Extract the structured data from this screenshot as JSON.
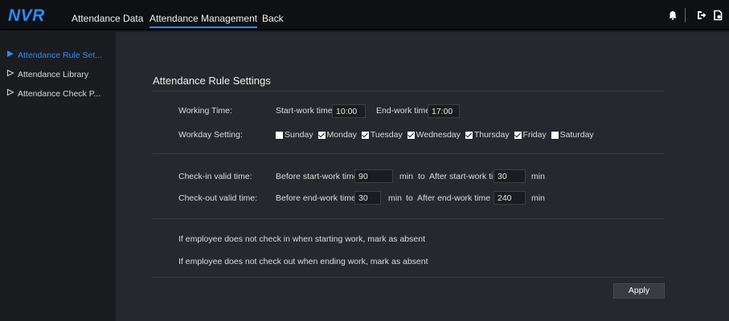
{
  "header": {
    "logo": "NVR",
    "nav": [
      "Attendance Data",
      "Attendance Management",
      "Back"
    ],
    "icons": [
      "bell-icon",
      "logout-icon",
      "export-icon"
    ]
  },
  "sidebar": {
    "items": [
      {
        "label": "Attendance Rule Set...",
        "active": true
      },
      {
        "label": "Attendance Library",
        "active": false
      },
      {
        "label": "Attendance Check P...",
        "active": false
      }
    ]
  },
  "main": {
    "title": "Attendance Rule Settings",
    "working_time": {
      "label": "Working Time:",
      "start_label": "Start-work time",
      "start_value": "10:00",
      "end_label": "End-work time",
      "end_value": "17:00"
    },
    "workday": {
      "label": "Workday Setting:",
      "days": [
        {
          "name": "Sunday",
          "checked": false
        },
        {
          "name": "Monday",
          "checked": true
        },
        {
          "name": "Tuesday",
          "checked": true
        },
        {
          "name": "Wednesday",
          "checked": true
        },
        {
          "name": "Thursday",
          "checked": true
        },
        {
          "name": "Friday",
          "checked": true
        },
        {
          "name": "Saturday",
          "checked": false
        }
      ]
    },
    "checkin": {
      "label": "Check-in valid time:",
      "before_label": "Before start-work time",
      "before_value": "90",
      "unit": "min",
      "to": "to",
      "after_label": "After start-work time",
      "after_value": "30"
    },
    "checkout": {
      "label": "Check-out valid time:",
      "before_label": "Before end-work time",
      "before_value": "30",
      "unit": "min",
      "to": "to",
      "after_label": "After end-work time",
      "after_value": "240"
    },
    "rule1": "If employee does not check in when starting work, mark as absent",
    "rule2": "If employee does not check out when ending work, mark as absent",
    "apply_label": "Apply"
  },
  "colors": {
    "accent": "#2b8cff",
    "topbar": "#0f1013",
    "panel": "#27282d"
  }
}
